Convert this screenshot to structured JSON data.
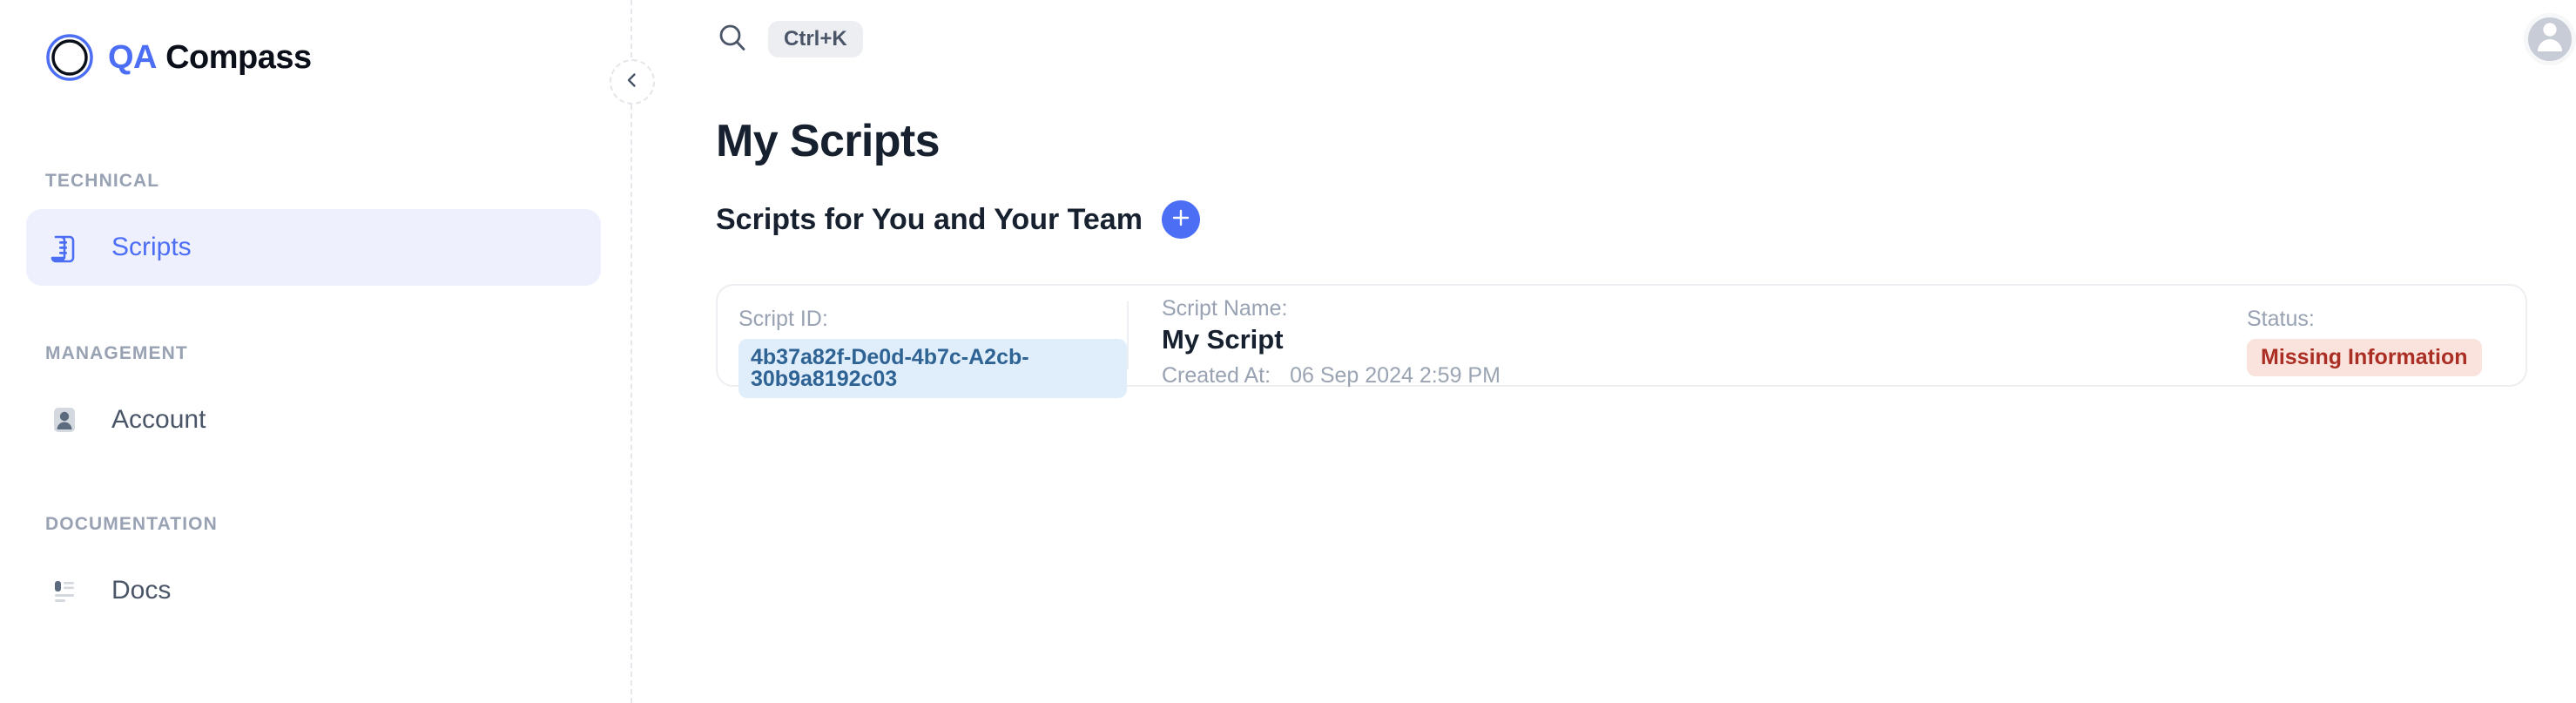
{
  "brand": {
    "icon": "compass-icon",
    "name_primary": "QA",
    "name_secondary": "Compass"
  },
  "sidebar": {
    "collapse_icon": "chevron-left-icon",
    "sections": [
      {
        "label": "TECHNICAL",
        "items": [
          {
            "label": "Scripts",
            "icon": "scroll-icon",
            "active": true
          }
        ]
      },
      {
        "label": "MANAGEMENT",
        "items": [
          {
            "label": "Account",
            "icon": "user-card-icon",
            "active": false
          }
        ]
      },
      {
        "label": "DOCUMENTATION",
        "items": [
          {
            "label": "Docs",
            "icon": "document-list-icon",
            "active": false
          }
        ]
      }
    ]
  },
  "topbar": {
    "search_icon": "search-icon",
    "search_shortcut": "Ctrl+K",
    "avatar_icon": "user-avatar-icon"
  },
  "main": {
    "page_title": "My Scripts",
    "section_title": "Scripts for You and Your Team",
    "add_button_icon": "plus-icon",
    "labels": {
      "script_id": "Script ID:",
      "script_name": "Script Name:",
      "created_at": "Created At:",
      "status": "Status:"
    },
    "scripts": [
      {
        "script_id": "4b37a82f-De0d-4b7c-A2cb-30b9a8192c03",
        "script_name": "My Script",
        "created_at": "06 Sep 2024 2:59 PM",
        "status": "Missing Information"
      }
    ]
  },
  "colors": {
    "accent": "#4c6ef5",
    "active_nav_bg": "#eef1fd",
    "id_chip_bg": "#e0eefb",
    "id_chip_text": "#2e6394",
    "status_bg": "#fbe3dd",
    "status_text": "#ab2e24",
    "muted_text": "#98a2b3",
    "heading_text": "#16202e"
  }
}
